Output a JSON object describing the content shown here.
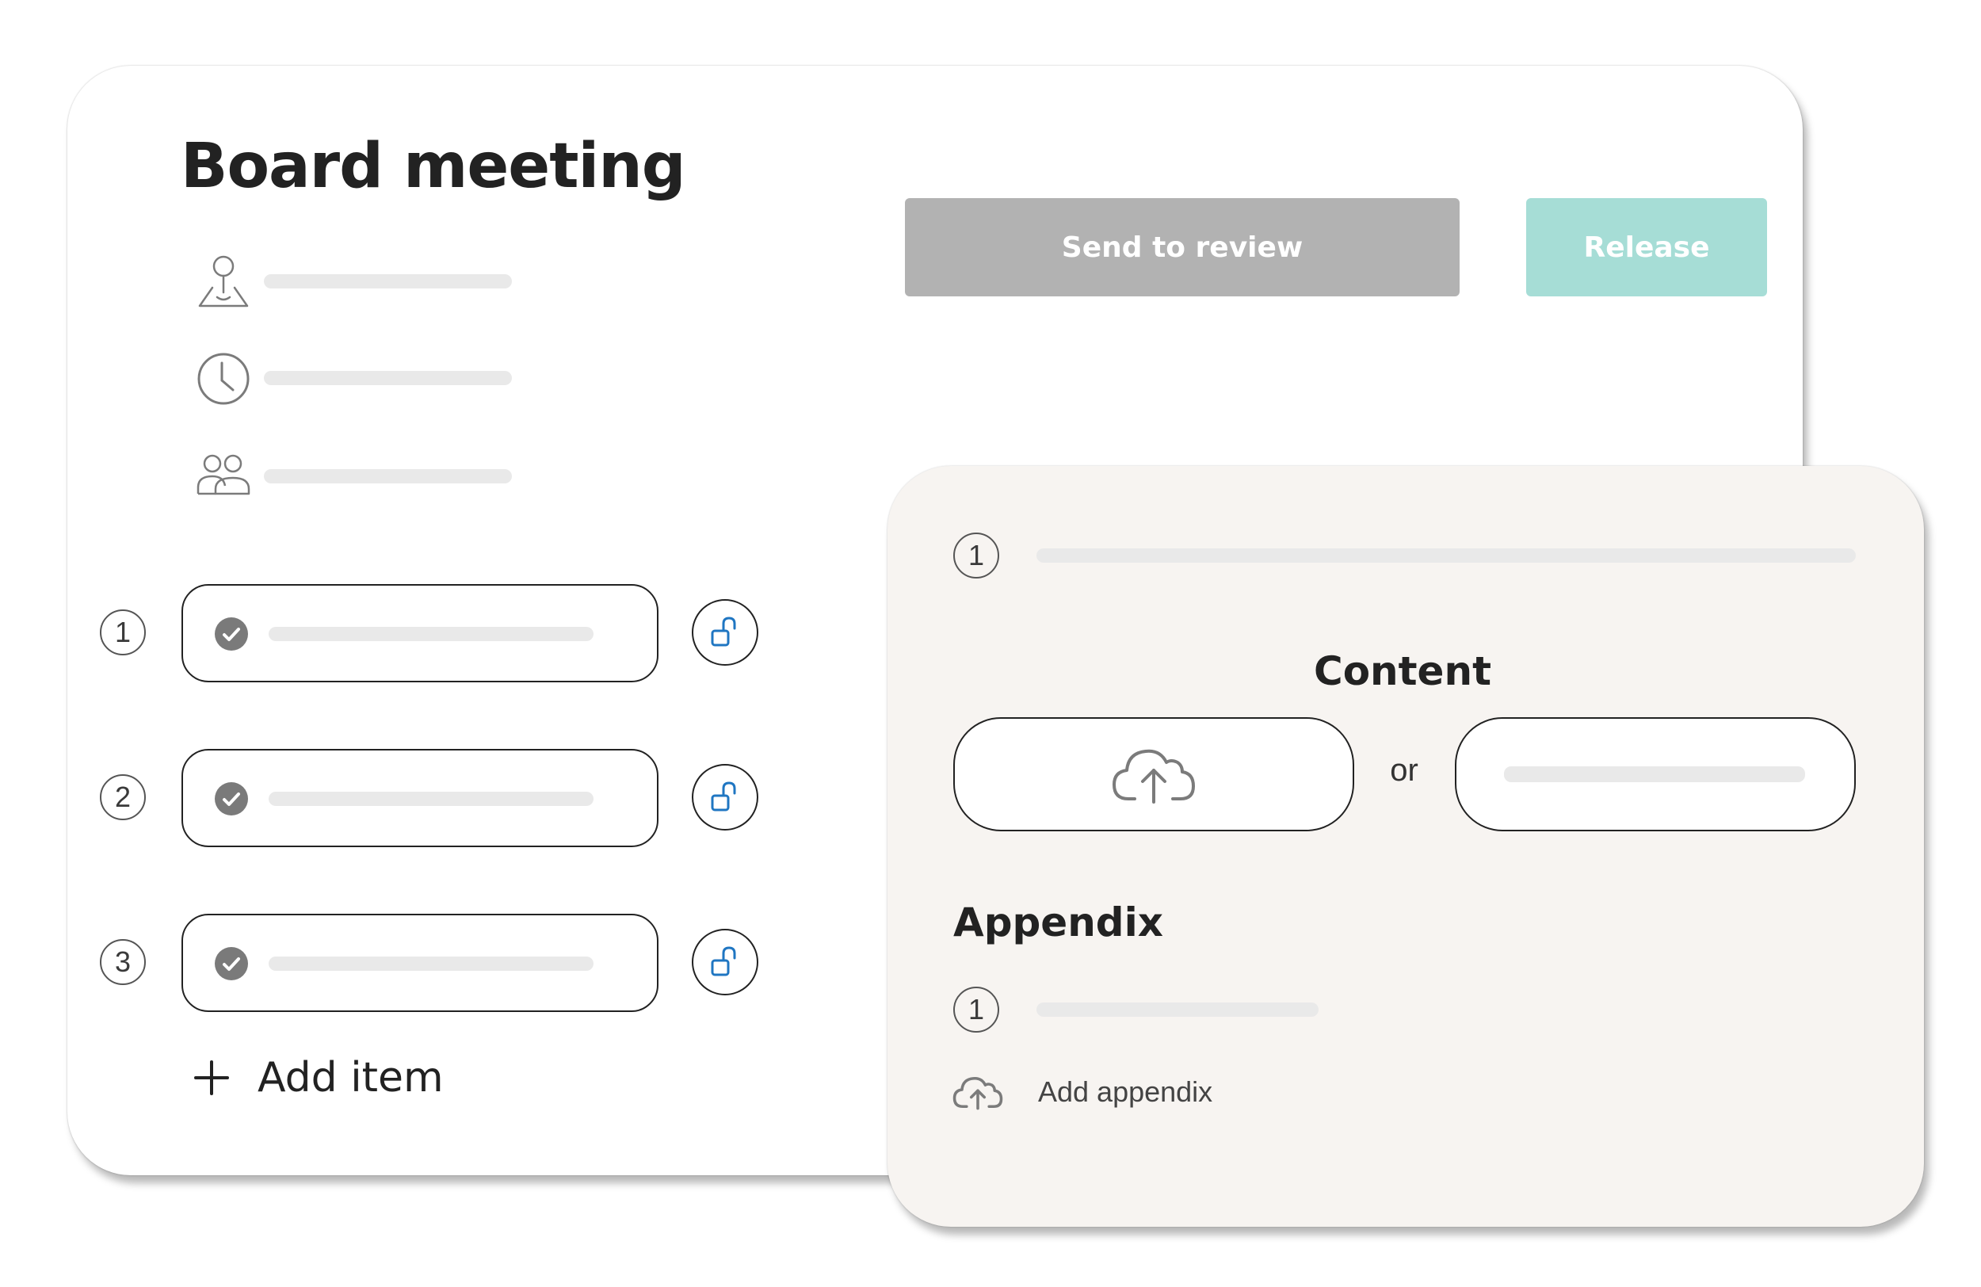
{
  "meeting": {
    "title": "Board meeting",
    "meta": [
      {
        "icon": "location-pin-icon"
      },
      {
        "icon": "clock-icon"
      },
      {
        "icon": "participants-icon"
      }
    ]
  },
  "actions": {
    "send_to_review": "Send to review",
    "release": "Release",
    "release_color": "#a6ddd6",
    "review_color": "#b2b2b2"
  },
  "agenda": {
    "items": [
      {
        "number": "1",
        "status": "check-icon",
        "lock": "unlock-icon"
      },
      {
        "number": "2",
        "status": "check-icon",
        "lock": "unlock-icon"
      },
      {
        "number": "3",
        "status": "check-icon",
        "lock": "unlock-icon"
      }
    ],
    "add_item": "Add item",
    "lock_color": "#1f76c2"
  },
  "detail_panel": {
    "item_number": "1",
    "content_heading": "Content",
    "or_label": "or",
    "upload_icon": "cloud-upload-icon",
    "appendix_heading": "Appendix",
    "appendix_items": [
      {
        "number": "1"
      }
    ],
    "add_appendix": "Add appendix"
  }
}
